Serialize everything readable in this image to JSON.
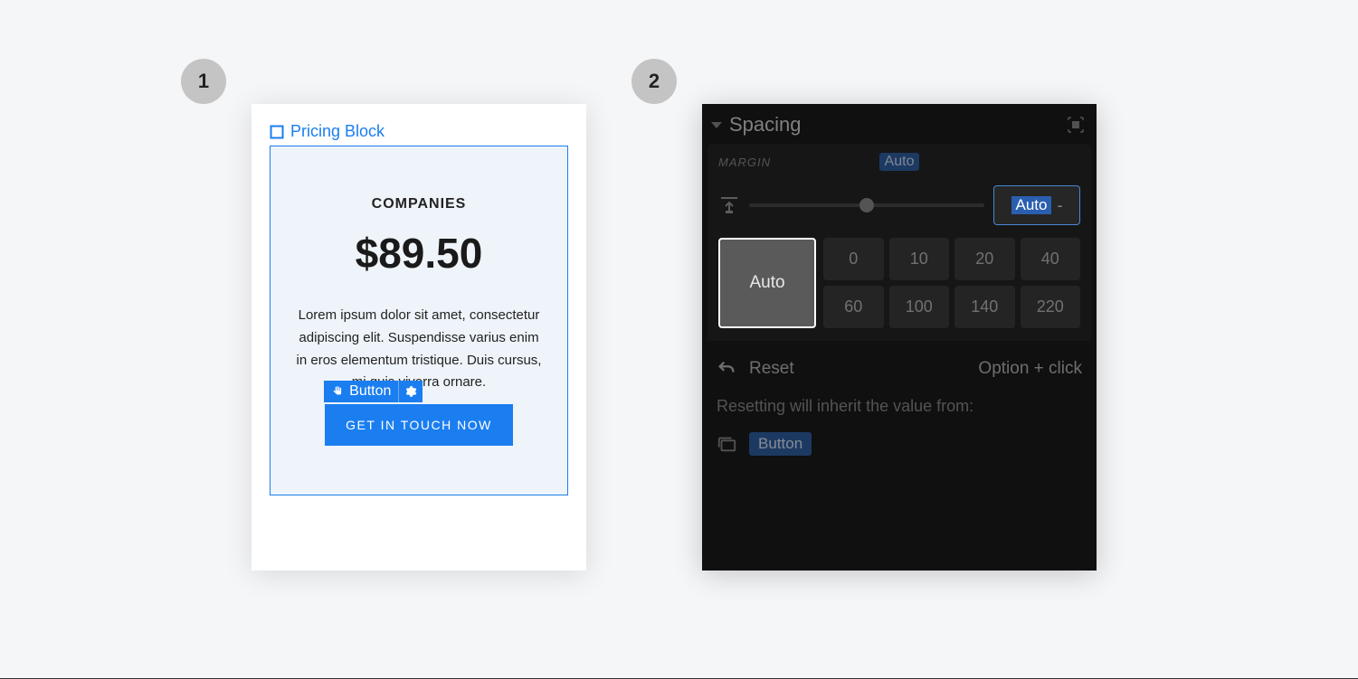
{
  "steps": {
    "one": "1",
    "two": "2"
  },
  "panel1": {
    "block_label": "Pricing Block",
    "plan": "COMPANIES",
    "price": "$89.50",
    "description": "Lorem ipsum dolor sit amet, consectetur adipiscing elit. Suspendisse varius enim in eros elementum tristique. Duis cursus, mi quis viverra ornare.",
    "button_tag": "Button",
    "cta": "GET IN TOUCH NOW"
  },
  "panel2": {
    "section": "Spacing",
    "margin_label": "MARGIN",
    "auto_chip": "Auto",
    "value": "Auto",
    "unit": "-",
    "auto_preset": "Auto",
    "presets": [
      "0",
      "10",
      "20",
      "40",
      "60",
      "100",
      "140",
      "220"
    ],
    "reset": "Reset",
    "shortcut": "Option + click",
    "inherit_text": "Resetting will inherit the value from:",
    "inherit_source": "Button"
  }
}
